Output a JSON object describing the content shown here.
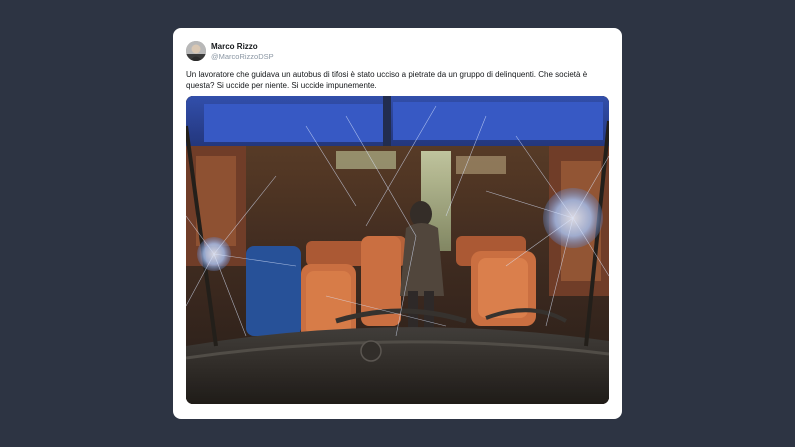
{
  "tweet": {
    "display_name": "Marco Rizzo",
    "handle": "@MarcoRizzoDSP",
    "text": "Un lavoratore che guidava un autobus di tifosi è stato ucciso a pietrate da un gruppo di delinquenti. Che società è questa? Si uccide per niente. Si uccide impunemente.",
    "avatar_icon": "user-avatar-photo",
    "media_description_icon": "bus-photo"
  },
  "colors": {
    "page_background": "#2d3443",
    "card_background": "#ffffff",
    "handle_color": "#8a96a3",
    "text_color": "#14171a"
  }
}
